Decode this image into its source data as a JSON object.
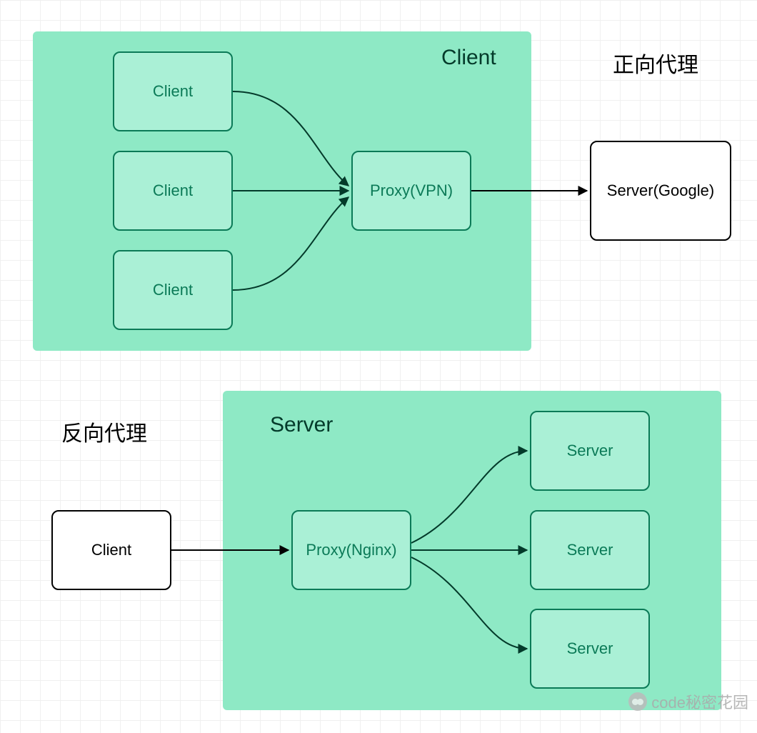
{
  "forward": {
    "group_label": "Client",
    "external_title": "正向代理",
    "clients": [
      "Client",
      "Client",
      "Client"
    ],
    "proxy": "Proxy(VPN)",
    "server": "Server(Google)"
  },
  "reverse": {
    "group_label": "Server",
    "external_title": "反向代理",
    "client": "Client",
    "proxy": "Proxy(Nginx)",
    "servers": [
      "Server",
      "Server",
      "Server"
    ]
  },
  "watermark": "code秘密花园",
  "colors": {
    "group_bg": "#8ee9c5",
    "node_fill": "#aaf0d6",
    "node_border": "#0b7a57"
  }
}
